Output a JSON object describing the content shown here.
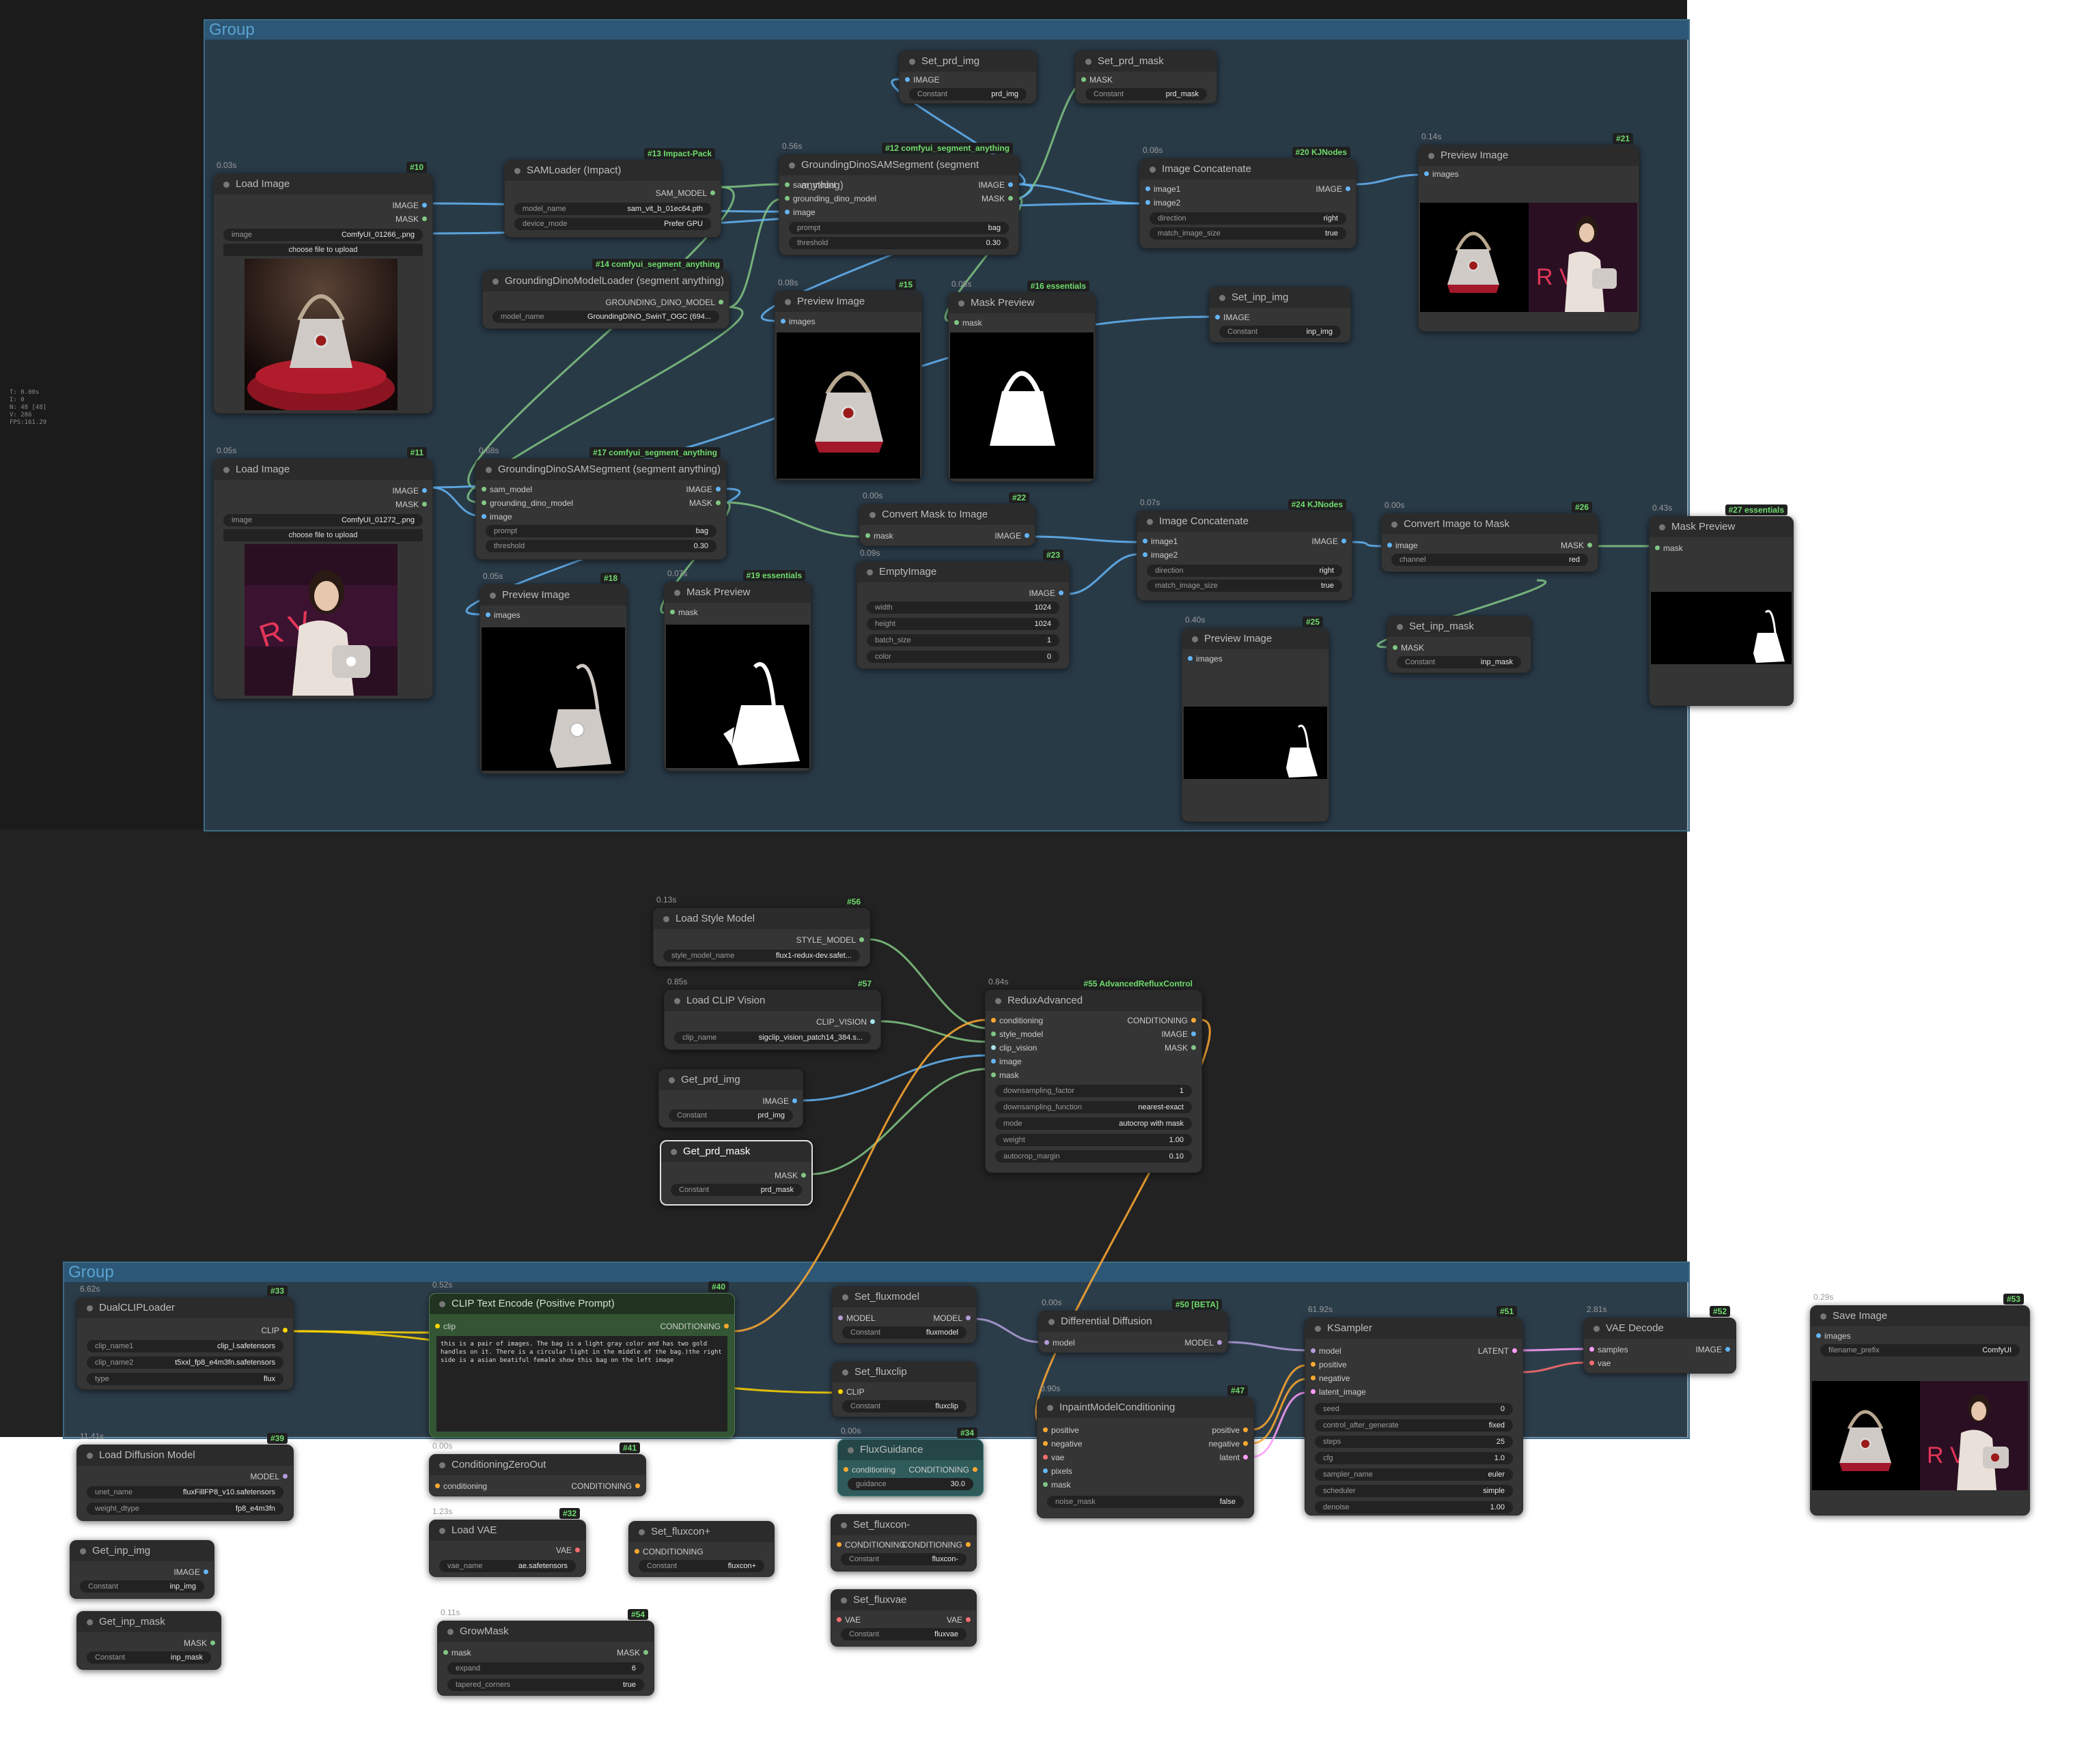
{
  "canvas": {
    "background": "#222222"
  },
  "stats": [
    "T: 0.00s",
    "I: 0",
    "N: 48 [48]",
    "V: 286",
    "FPS:161.29"
  ],
  "groups": [
    {
      "title": "Group"
    },
    {
      "title": "Group"
    }
  ],
  "colors": {
    "image": "#64b5f6",
    "mask": "#81c784",
    "model": "#b39ddb",
    "clip": "#ffd500",
    "conditioning": "#ffa931",
    "latent": "#ff9cf9",
    "vae": "#ff6e6e"
  },
  "nodes": {
    "n10": {
      "badge": "#10",
      "time": "0.03s",
      "title": "Load Image",
      "out1": "IMAGE",
      "out2": "MASK",
      "w_label": "image",
      "w_value": "ComfyUI_01266_.png",
      "button": "choose file to upload"
    },
    "n11": {
      "badge": "#11",
      "time": "0.05s",
      "title": "Load Image",
      "out1": "IMAGE",
      "out2": "MASK",
      "w_label": "image",
      "w_value": "ComfyUI_01272_.png",
      "button": "choose file to upload"
    },
    "n13": {
      "badge": "#13 Impact-Pack",
      "title": "SAMLoader (Impact)",
      "out1": "SAM_MODEL",
      "w1_label": "model_name",
      "w1_value": "sam_vit_b_01ec64.pth",
      "w2_label": "device_mode",
      "w2_value": "Prefer GPU"
    },
    "n14": {
      "badge": "#14 comfyui_segment_anything",
      "title": "GroundingDinoModelLoader (segment anything)",
      "out1": "GROUNDING_DINO_MODEL",
      "w1_label": "model_name",
      "w1_value": "GroundingDINO_SwinT_OGC (694..."
    },
    "n12": {
      "badge": "#12 comfyui_segment_anything",
      "time": "0.56s",
      "title": "GroundingDinoSAMSegment (segment anything)",
      "in1": "sam_model",
      "in2": "grounding_dino_model",
      "in3": "image",
      "out1": "IMAGE",
      "out2": "MASK",
      "w1_label": "prompt",
      "w1_value": "bag",
      "w2_label": "threshold",
      "w2_value": "0.30"
    },
    "n17": {
      "badge": "#17 comfyui_segment_anything",
      "time": "0.68s",
      "title": "GroundingDinoSAMSegment (segment anything)",
      "in1": "sam_model",
      "in2": "grounding_dino_model",
      "in3": "image",
      "out1": "IMAGE",
      "out2": "MASK",
      "w1_label": "prompt",
      "w1_value": "bag",
      "w2_label": "threshold",
      "w2_value": "0.30"
    },
    "set_prd_img": {
      "title": "Set_prd_img",
      "in1": "IMAGE",
      "w_label": "Constant",
      "w_value": "prd_img"
    },
    "set_prd_mask": {
      "title": "Set_prd_mask",
      "in1": "MASK",
      "w_label": "Constant",
      "w_value": "prd_mask"
    },
    "n15": {
      "badge": "#15",
      "time": "0.08s",
      "title": "Preview Image",
      "in1": "images"
    },
    "n16": {
      "badge": "#16 essentials",
      "time": "0.08s",
      "title": "Mask Preview",
      "in1": "mask"
    },
    "n20": {
      "badge": "#20 KJNodes",
      "time": "0.08s",
      "title": "Image Concatenate",
      "in1": "image1",
      "in2": "image2",
      "out1": "IMAGE",
      "w1_label": "direction",
      "w1_value": "right",
      "w2_label": "match_image_size",
      "w2_value": "true"
    },
    "n21": {
      "badge": "#21",
      "time": "0.14s",
      "title": "Preview Image",
      "in1": "images"
    },
    "set_inp_img": {
      "title": "Set_inp_img",
      "in1": "IMAGE",
      "w_label": "Constant",
      "w_value": "inp_img"
    },
    "n18": {
      "badge": "#18",
      "time": "0.05s",
      "title": "Preview Image",
      "in1": "images"
    },
    "n19": {
      "badge": "#19 essentials",
      "time": "0.07s",
      "title": "Mask Preview",
      "in1": "mask"
    },
    "n22": {
      "badge": "#22",
      "time": "0.00s",
      "title": "Convert Mask to Image",
      "in1": "mask",
      "out1": "IMAGE"
    },
    "n23": {
      "badge": "#23",
      "time": "0.09s",
      "title": "EmptyImage",
      "out1": "IMAGE",
      "w1_label": "width",
      "w1_value": "1024",
      "w2_label": "height",
      "w2_value": "1024",
      "w3_label": "batch_size",
      "w3_value": "1",
      "w4_label": "color",
      "w4_value": "0"
    },
    "n24": {
      "badge": "#24 KJNodes",
      "time": "0.07s",
      "title": "Image Concatenate",
      "in1": "image1",
      "in2": "image2",
      "out1": "IMAGE",
      "w1_label": "direction",
      "w1_value": "right",
      "w2_label": "match_image_size",
      "w2_value": "true"
    },
    "n25": {
      "badge": "#25",
      "time": "0.40s",
      "title": "Preview Image",
      "in1": "images"
    },
    "n26": {
      "badge": "#26",
      "time": "0.00s",
      "title": "Convert Image to Mask",
      "in1": "image",
      "out1": "MASK",
      "w1_label": "channel",
      "w1_value": "red"
    },
    "set_inp_mask": {
      "title": "Set_inp_mask",
      "in1": "MASK",
      "w_label": "Constant",
      "w_value": "inp_mask"
    },
    "n27": {
      "badge": "#27 essentials",
      "time": "0.43s",
      "title": "Mask Preview",
      "in1": "mask"
    },
    "n56": {
      "badge": "#56",
      "time": "0.13s",
      "title": "Load Style Model",
      "out1": "STYLE_MODEL",
      "w1_label": "style_model_name",
      "w1_value": "flux1-redux-dev.safet..."
    },
    "n57": {
      "badge": "#57",
      "time": "0.85s",
      "title": "Load CLIP Vision",
      "out1": "CLIP_VISION",
      "w1_label": "clip_name",
      "w1_value": "sigclip_vision_patch14_384.s..."
    },
    "get_prd_img": {
      "title": "Get_prd_img",
      "out1": "IMAGE",
      "w_label": "Constant",
      "w_value": "prd_img"
    },
    "get_prd_mask": {
      "title": "Get_prd_mask",
      "out1": "MASK",
      "w_label": "Constant",
      "w_value": "prd_mask"
    },
    "n55": {
      "badge": "#55 AdvancedRefluxControl",
      "time": "0.84s",
      "title": "ReduxAdvanced",
      "in1": "conditioning",
      "in2": "style_model",
      "in3": "clip_vision",
      "in4": "image",
      "in5": "mask",
      "out1": "CONDITIONING",
      "out2": "IMAGE",
      "out3": "MASK",
      "w1_label": "downsampling_factor",
      "w1_value": "1",
      "w2_label": "downsampling_function",
      "w2_value": "nearest-exact",
      "w3_label": "mode",
      "w3_value": "autocrop with mask",
      "w4_label": "weight",
      "w4_value": "1.00",
      "w5_label": "autocrop_margin",
      "w5_value": "0.10"
    },
    "n33": {
      "badge": "#33",
      "time": "6.62s",
      "title": "DualCLIPLoader",
      "out1": "CLIP",
      "w1_label": "clip_name1",
      "w1_value": "clip_l.safetensors",
      "w2_label": "clip_name2",
      "w2_value": "t5xxl_fp8_e4m3fn.safetensors",
      "w3_label": "type",
      "w3_value": "flux"
    },
    "n40": {
      "badge": "#40",
      "time": "0.52s",
      "title": "CLIP Text Encode (Positive Prompt)",
      "in1": "clip",
      "out1": "CONDITIONING",
      "text": "this is a pair of images. The bag is a light gray color and has two gold handles on it. There is a circular light in the middle of the bag.)the right side is a asian beatiful female show this bag on the left image"
    },
    "set_fluxmodel": {
      "title": "Set_fluxmodel",
      "in1": "MODEL",
      "out1": "MODEL",
      "w_label": "Constant",
      "w_value": "fluxmodel"
    },
    "set_fluxclip": {
      "title": "Set_fluxclip",
      "in1": "CLIP",
      "w_label": "Constant",
      "w_value": "fluxclip"
    },
    "n50": {
      "badge": "#50 [BETA]",
      "time": "0.00s",
      "title": "Differential Diffusion",
      "in1": "model",
      "out1": "MODEL"
    },
    "n47": {
      "badge": "#47",
      "time": "0.90s",
      "title": "InpaintModelConditioning",
      "in1": "positive",
      "in2": "negative",
      "in3": "vae",
      "in4": "pixels",
      "in5": "mask",
      "out1": "positive",
      "out2": "negative",
      "out3": "latent",
      "w1_label": "noise_mask",
      "w1_value": "false"
    },
    "n51": {
      "badge": "#51",
      "time": "61.92s",
      "title": "KSampler",
      "in1": "model",
      "in2": "positive",
      "in3": "negative",
      "in4": "latent_image",
      "out1": "LATENT",
      "w1_label": "seed",
      "w1_value": "0",
      "w2_label": "control_after_generate",
      "w2_value": "fixed",
      "w3_label": "steps",
      "w3_value": "25",
      "w4_label": "cfg",
      "w4_value": "1.0",
      "w5_label": "sampler_name",
      "w5_value": "euler",
      "w6_label": "scheduler",
      "w6_value": "simple",
      "w7_label": "denoise",
      "w7_value": "1.00"
    },
    "n52": {
      "badge": "#52",
      "time": "2.81s",
      "title": "VAE Decode",
      "in1": "samples",
      "in2": "vae",
      "out1": "IMAGE"
    },
    "n53": {
      "badge": "#53",
      "time": "0.29s",
      "title": "Save Image",
      "in1": "images",
      "w1_label": "filename_prefix",
      "w1_value": "ComfyUI"
    },
    "n39": {
      "badge": "#39",
      "time": "11.41s",
      "title": "Load Diffusion Model",
      "out1": "MODEL",
      "w1_label": "unet_name",
      "w1_value": "fluxFillFP8_v10.safetensors",
      "w2_label": "weight_dtype",
      "w2_value": "fp8_e4m3fn"
    },
    "n41": {
      "badge": "#41",
      "time": "0.00s",
      "title": "ConditioningZeroOut",
      "in1": "conditioning",
      "out1": "CONDITIONING"
    },
    "n34": {
      "badge": "#34",
      "time": "0.00s",
      "title": "FluxGuidance",
      "in1": "conditioning",
      "out1": "CONDITIONING",
      "w1_label": "guidance",
      "w1_value": "30.0"
    },
    "n32": {
      "badge": "#32",
      "time": "1.23s",
      "title": "Load VAE",
      "out1": "VAE",
      "w1_label": "vae_name",
      "w1_value": "ae.safetensors"
    },
    "set_fluxconp": {
      "title": "Set_fluxcon+",
      "in1": "CONDITIONING",
      "w_label": "Constant",
      "w_value": "fluxcon+"
    },
    "set_fluxconm": {
      "title": "Set_fluxcon-",
      "in1": "CONDITIONING",
      "out1": "CONDITIONING",
      "w_label": "Constant",
      "w_value": "fluxcon-"
    },
    "set_fluxvae": {
      "title": "Set_fluxvae",
      "in1": "VAE",
      "out1": "VAE",
      "w_label": "Constant",
      "w_value": "fluxvae"
    },
    "get_inp_img": {
      "title": "Get_inp_img",
      "out1": "IMAGE",
      "w_label": "Constant",
      "w_value": "inp_img"
    },
    "get_inp_mask": {
      "title": "Get_inp_mask",
      "out1": "MASK",
      "w_label": "Constant",
      "w_value": "inp_mask"
    },
    "n54": {
      "badge": "#54",
      "time": "0.11s",
      "title": "GrowMask",
      "in1": "mask",
      "out1": "MASK",
      "w1_label": "expand",
      "w1_value": "6",
      "w2_label": "tapered_corners",
      "w2_value": "true"
    }
  }
}
